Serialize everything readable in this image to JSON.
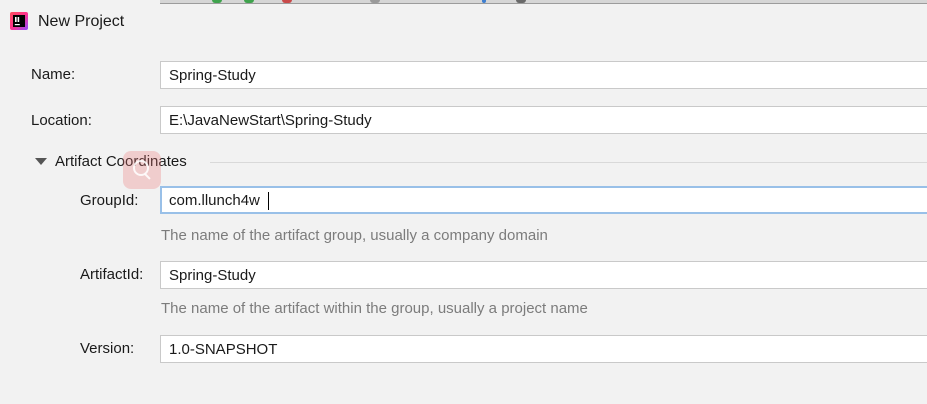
{
  "window": {
    "title": "New Project",
    "icon": "intellij-idea-icon"
  },
  "form": {
    "name": {
      "label": "Name:",
      "value": "Spring-Study"
    },
    "location": {
      "label": "Location:",
      "value": "E:\\JavaNewStart\\Spring-Study"
    },
    "artifact_section": {
      "label": "Artifact Coordinates",
      "expanded": true,
      "group_id": {
        "label": "GroupId:",
        "value": "com.llunch4w",
        "hint": "The name of the artifact group, usually a company domain",
        "focused": true
      },
      "artifact_id": {
        "label": "ArtifactId:",
        "value": "Spring-Study",
        "hint": "The name of the artifact within the group, usually a project name"
      },
      "version": {
        "label": "Version:",
        "value": "1.0-SNAPSHOT"
      }
    }
  },
  "colors": {
    "background": "#f2f2f2",
    "focus_border": "#99c0e8",
    "hint_text": "#7c7c7c"
  }
}
